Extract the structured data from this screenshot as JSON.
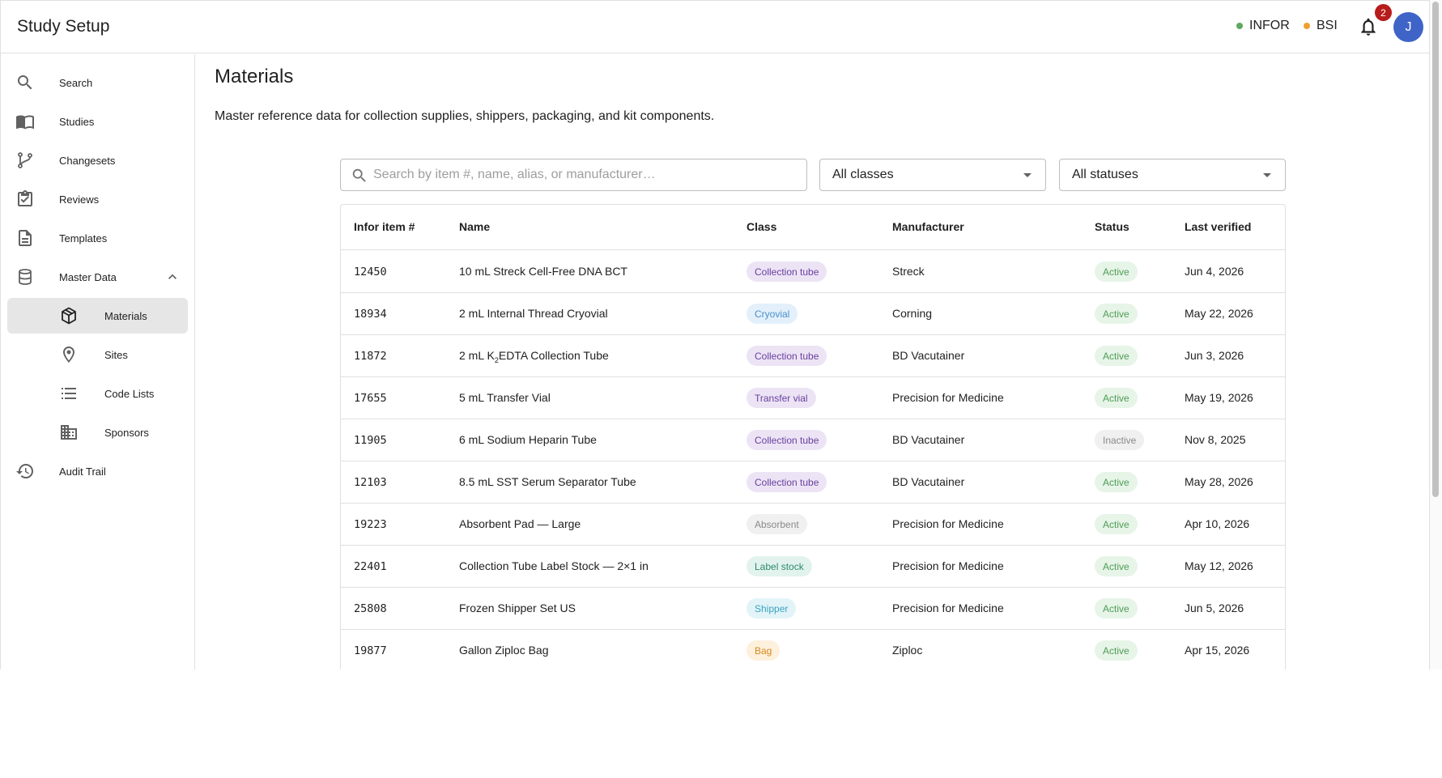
{
  "header": {
    "title": "Study Setup",
    "systems": [
      {
        "label": "INFOR",
        "color": "#5fa85f"
      },
      {
        "label": "BSI",
        "color": "#f0a030"
      }
    ],
    "notification_count": "2",
    "avatar_initial": "J"
  },
  "sidebar": {
    "items": [
      {
        "label": "Search",
        "icon": "search-icon"
      },
      {
        "label": "Studies",
        "icon": "book-icon"
      },
      {
        "label": "Changesets",
        "icon": "branch-icon"
      },
      {
        "label": "Reviews",
        "icon": "clipboard-check-icon"
      },
      {
        "label": "Templates",
        "icon": "document-icon"
      },
      {
        "label": "Master Data",
        "icon": "database-icon",
        "expanded": true
      },
      {
        "label": "Materials",
        "icon": "cube-icon",
        "active": true
      },
      {
        "label": "Sites",
        "icon": "map-pin-icon"
      },
      {
        "label": "Code Lists",
        "icon": "list-icon"
      },
      {
        "label": "Sponsors",
        "icon": "building-icon"
      },
      {
        "label": "Audit Trail",
        "icon": "history-icon"
      }
    ]
  },
  "main": {
    "title": "Materials",
    "description": "Master reference data for collection supplies, shippers, packaging, and kit components.",
    "search": {
      "placeholder": "Search by item #, name, alias, or manufacturer…",
      "value": ""
    },
    "class_filter": "All classes",
    "status_filter": "All statuses"
  },
  "table": {
    "columns": [
      "Infor item #",
      "Name",
      "Class",
      "Manufacturer",
      "Status",
      "Last verified"
    ],
    "rows": [
      {
        "item": "12450",
        "name": "10 mL Streck Cell-Free DNA BCT",
        "class": "Collection tube",
        "manufacturer": "Streck",
        "status": "Active",
        "verified": "Jun 4, 2026"
      },
      {
        "item": "18934",
        "name": "2 mL Internal Thread Cryovial",
        "class": "Cryovial",
        "manufacturer": "Corning",
        "status": "Active",
        "verified": "May 22, 2026"
      },
      {
        "item": "11872",
        "name_prefix": "2 mL K",
        "name_sub": "2",
        "name_suffix": "EDTA Collection Tube",
        "class": "Collection tube",
        "manufacturer": "BD Vacutainer",
        "status": "Active",
        "verified": "Jun 3, 2026"
      },
      {
        "item": "17655",
        "name": "5 mL Transfer Vial",
        "class": "Transfer vial",
        "manufacturer": "Precision for Medicine",
        "status": "Active",
        "verified": "May 19, 2026"
      },
      {
        "item": "11905",
        "name": "6 mL Sodium Heparin Tube",
        "class": "Collection tube",
        "manufacturer": "BD Vacutainer",
        "status": "Inactive",
        "verified": "Nov 8, 2025"
      },
      {
        "item": "12103",
        "name": "8.5 mL SST Serum Separator Tube",
        "class": "Collection tube",
        "manufacturer": "BD Vacutainer",
        "status": "Active",
        "verified": "May 28, 2026"
      },
      {
        "item": "19223",
        "name": "Absorbent Pad — Large",
        "class": "Absorbent",
        "manufacturer": "Precision for Medicine",
        "status": "Active",
        "verified": "Apr 10, 2026"
      },
      {
        "item": "22401",
        "name": "Collection Tube Label Stock — 2×1 in",
        "class": "Label stock",
        "manufacturer": "Precision for Medicine",
        "status": "Active",
        "verified": "May 12, 2026"
      },
      {
        "item": "25808",
        "name": "Frozen Shipper Set US",
        "class": "Shipper",
        "manufacturer": "Precision for Medicine",
        "status": "Active",
        "verified": "Jun 5, 2026"
      },
      {
        "item": "19877",
        "name": "Gallon Ziploc Bag",
        "class": "Bag",
        "manufacturer": "Ziploc",
        "status": "Active",
        "verified": "Apr 15, 2026"
      }
    ]
  },
  "chip_colors": {
    "Collection tube": {
      "bg": "#ece4f5",
      "fg": "#6a3fa0"
    },
    "Cryovial": {
      "bg": "#e3f0fb",
      "fg": "#4a8fc9"
    },
    "Transfer vial": {
      "bg": "#ece4f5",
      "fg": "#6a3fa0"
    },
    "Absorbent": {
      "bg": "#f0f0f0",
      "fg": "#8a8a8a"
    },
    "Label stock": {
      "bg": "#e2f3ee",
      "fg": "#2e8a6e"
    },
    "Shipper": {
      "bg": "#e2f4f8",
      "fg": "#3aa3bf"
    },
    "Bag": {
      "bg": "#fdf0dc",
      "fg": "#d98a20"
    },
    "Active": {
      "bg": "#e7f4e8",
      "fg": "#4e9e55"
    },
    "Inactive": {
      "bg": "#f0f0f0",
      "fg": "#8a8a8a"
    }
  }
}
